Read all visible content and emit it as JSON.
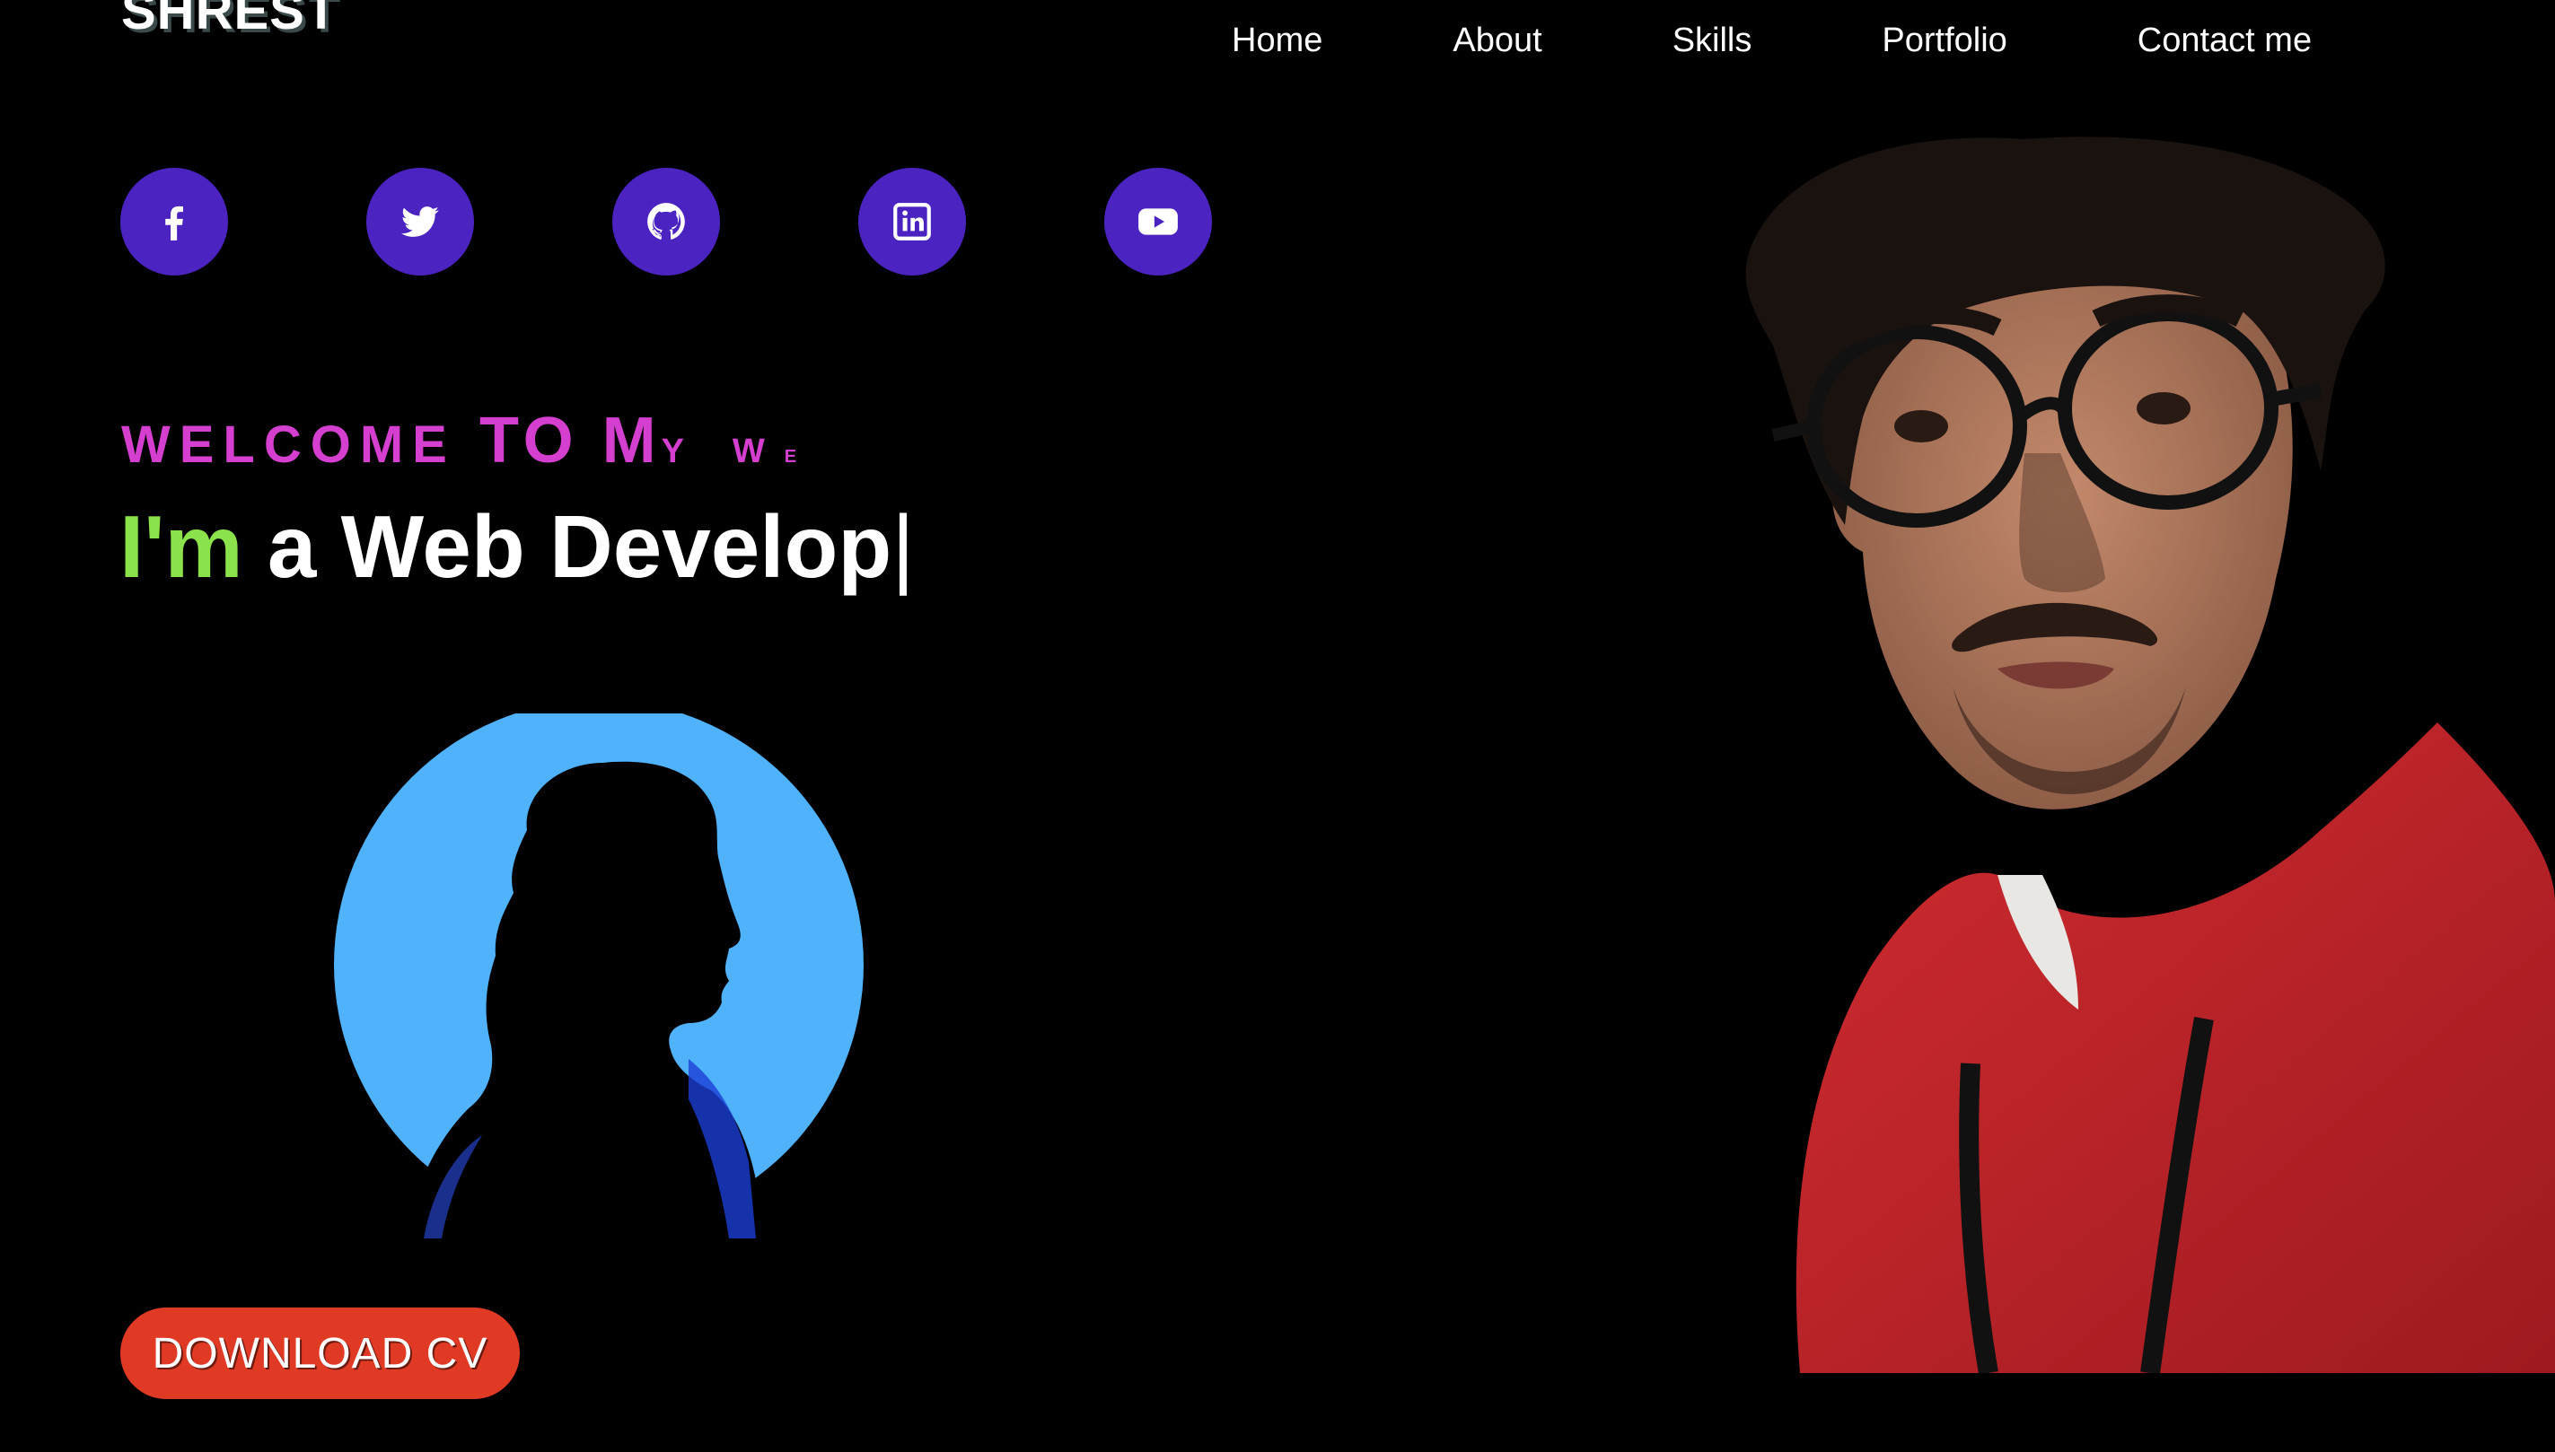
{
  "header": {
    "logo": "SHREST",
    "nav": [
      "Home",
      "About",
      "Skills",
      "Portfolio",
      "Contact me"
    ]
  },
  "socials": [
    {
      "name": "facebook-icon"
    },
    {
      "name": "twitter-icon"
    },
    {
      "name": "github-icon"
    },
    {
      "name": "linkedin-icon"
    },
    {
      "name": "youtube-icon"
    }
  ],
  "hero": {
    "welcome_part1": "WELCOME ",
    "welcome_part2": "TO M",
    "welcome_part3": "Y W",
    "welcome_part4": "E",
    "im": "I'm",
    "role": "a Web Develop",
    "cursor": "|"
  },
  "cta": {
    "download_label": "DOWNLOAD CV"
  },
  "colors": {
    "background": "#000000",
    "social_bg": "#4b23c1",
    "welcome": "#d43fd0",
    "im": "#8be24a",
    "download_bg": "#e03a25",
    "silhouette_circle": "#4fb2fb",
    "hoodie": "#c8262b"
  }
}
